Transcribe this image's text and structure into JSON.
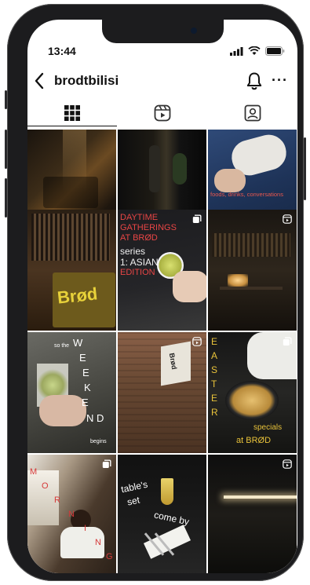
{
  "status_bar": {
    "time": "13:44"
  },
  "profile": {
    "username": "brodtbilisi"
  },
  "tabs": [
    {
      "name": "grid",
      "icon": "grid-icon",
      "active": true
    },
    {
      "name": "reels",
      "icon": "reels-icon",
      "active": false
    },
    {
      "name": "tagged",
      "icon": "tagged-person-icon",
      "active": false
    }
  ],
  "posts": {
    "p3": {
      "caption": "foods, drinks, conversations"
    },
    "p5": {
      "line1": "DAYTIME",
      "line2": "GATHERINGS",
      "line3": "AT BRØD",
      "line4": "series",
      "line5": "1: ASIAN",
      "line6": "EDITION",
      "badge": "carousel-icon"
    },
    "p4": {
      "sign": "Brød"
    },
    "p6": {
      "badge": "reels-icon"
    },
    "p7": {
      "so": "so the",
      "w": "W",
      "e1": "E",
      "e2": "E",
      "k": "K",
      "e3": "E",
      "nd": "N D",
      "begins": "begins"
    },
    "p8": {
      "sign": "Brød",
      "badge": "reels-icon"
    },
    "p9": {
      "e": "E",
      "a": "A",
      "s": "S",
      "t": "T",
      "e2": "E",
      "r": "R",
      "specials": "specials",
      "at": "at BRØD",
      "badge": "carousel-icon"
    },
    "p10": {
      "m": "M",
      "o": "O",
      "r": "R",
      "n": "N",
      "i": "I",
      "n2": "N",
      "g": "G",
      "badge": "carousel-icon"
    },
    "p11": {
      "l1": "table's",
      "l2": "set",
      "l3": "come by"
    },
    "p12": {
      "badge": "reels-icon"
    }
  },
  "colors": {
    "text_red": "#d43a3a",
    "text_yellow": "#e8c23a",
    "text_white": "#f4f4f4"
  }
}
